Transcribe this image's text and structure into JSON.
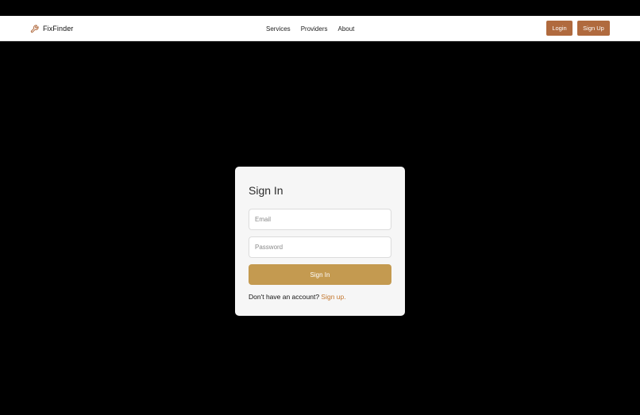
{
  "header": {
    "brand_name": "FixFinder",
    "brand_icon": "wrench-icon",
    "nav": [
      {
        "label": "Services"
      },
      {
        "label": "Providers"
      },
      {
        "label": "About"
      }
    ],
    "login_label": "Login",
    "signup_label": "Sign Up"
  },
  "signin": {
    "title": "Sign In",
    "email_placeholder": "Email",
    "password_placeholder": "Password",
    "submit_label": "Sign In",
    "prompt_text": "Don't have an account?",
    "signup_link": "Sign up."
  },
  "colors": {
    "background": "#000000",
    "nav_button": "#b06a3e",
    "submit_button": "#c49a50",
    "link": "#c4772e"
  }
}
